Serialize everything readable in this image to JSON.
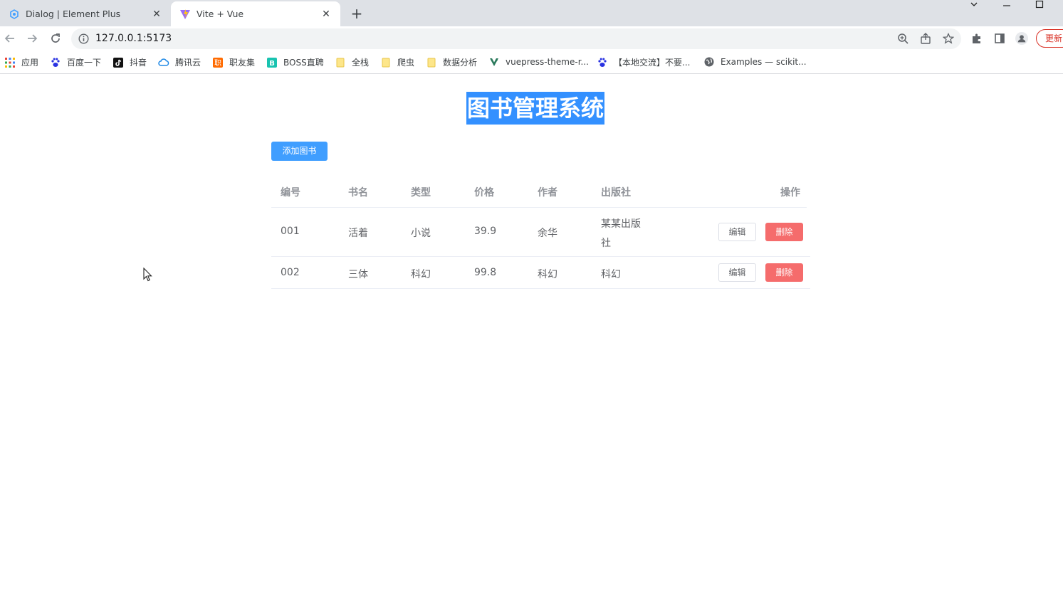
{
  "browser": {
    "tabs": [
      {
        "title": "Dialog | Element Plus",
        "active": false,
        "favicon": "element-plus-icon"
      },
      {
        "title": "Vite + Vue",
        "active": true,
        "favicon": "vite-icon"
      }
    ],
    "url": "127.0.0.1:5173",
    "update_label": "更新",
    "bookmarks": [
      {
        "label": "应用",
        "icon": "apps-grid-icon"
      },
      {
        "label": "百度一下",
        "icon": "baidu-paw-icon"
      },
      {
        "label": "抖音",
        "icon": "tiktok-icon"
      },
      {
        "label": "腾讯云",
        "icon": "cloud-icon"
      },
      {
        "label": "职友集",
        "icon": "zhiyouji-icon"
      },
      {
        "label": "BOSS直聘",
        "icon": "boss-icon"
      },
      {
        "label": "全栈",
        "icon": "folder-icon"
      },
      {
        "label": "爬虫",
        "icon": "folder-icon"
      },
      {
        "label": "数据分析",
        "icon": "folder-icon"
      },
      {
        "label": "vuepress-theme-r...",
        "icon": "vuepress-icon"
      },
      {
        "label": "【本地交流】不要...",
        "icon": "baidu-paw-icon"
      },
      {
        "label": "Examples — scikit...",
        "icon": "globe-icon"
      }
    ]
  },
  "page": {
    "title": "图书管理系统",
    "add_button": "添加图书",
    "table": {
      "headers": [
        "编号",
        "书名",
        "类型",
        "价格",
        "作者",
        "出版社",
        "操作"
      ],
      "rows": [
        {
          "id": "001",
          "name": "活着",
          "type": "小说",
          "price": "39.9",
          "author": "余华",
          "publisher_line1": "某某出版",
          "publisher_line2": "社",
          "edit": "编辑",
          "delete": "删除"
        },
        {
          "id": "002",
          "name": "三体",
          "type": "科幻",
          "price": "99.8",
          "author": "科幻",
          "publisher_line1": "科幻",
          "publisher_line2": "",
          "edit": "编辑",
          "delete": "删除"
        }
      ]
    }
  },
  "colors": {
    "primary": "#409eff",
    "danger": "#f56c6c",
    "title_highlight": "#3390ff"
  }
}
